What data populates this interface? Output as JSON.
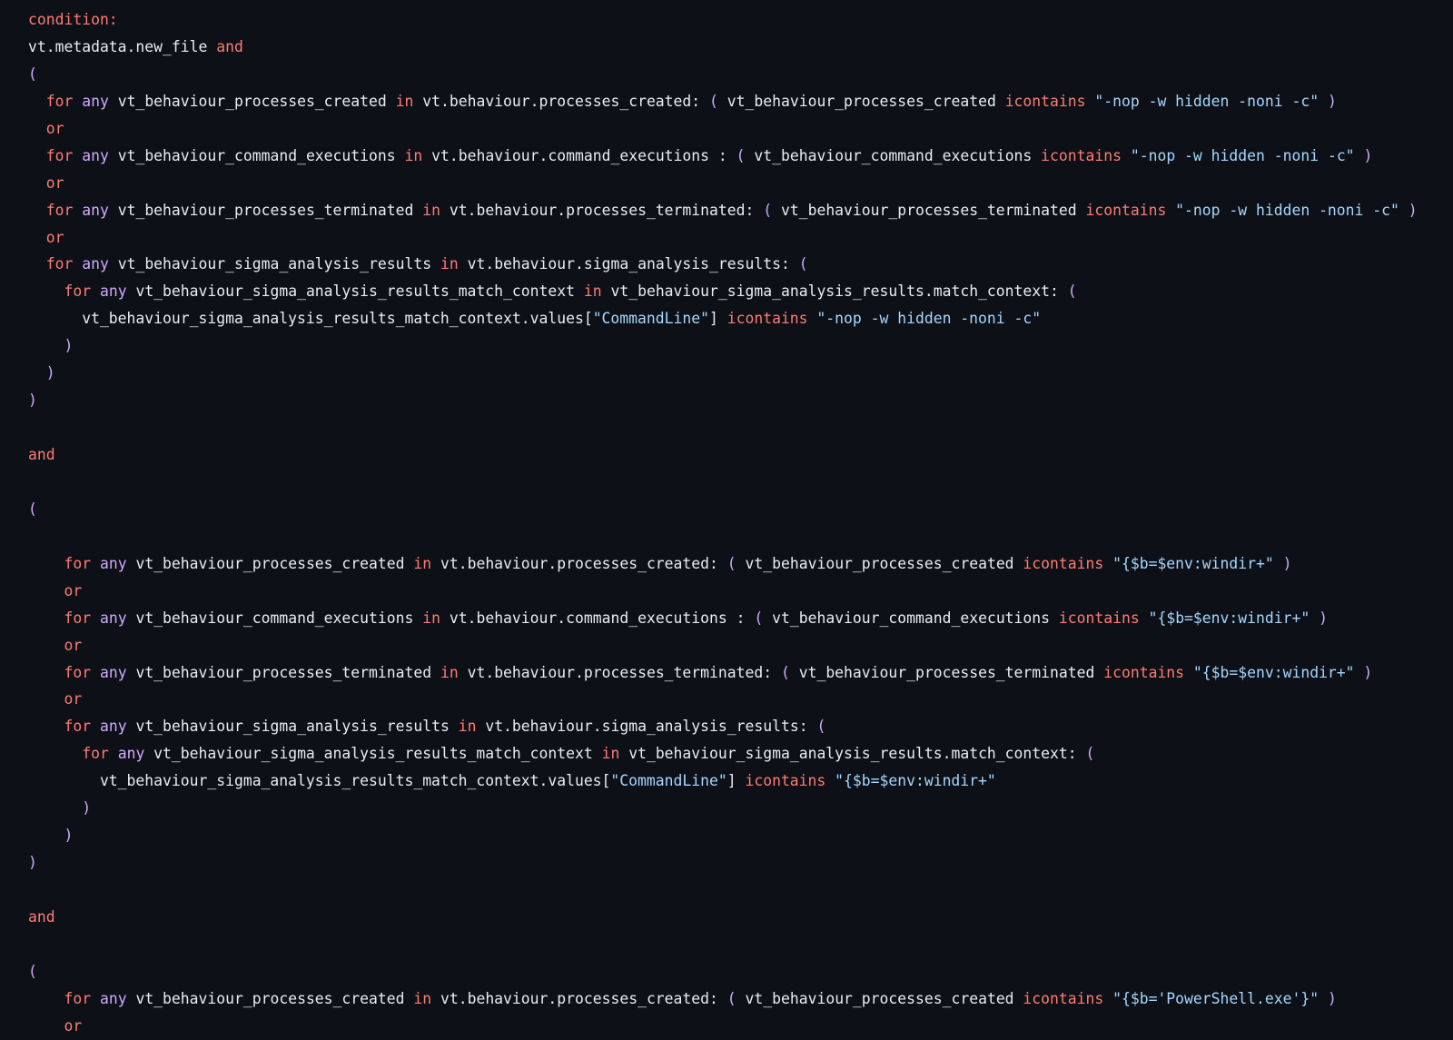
{
  "colors": {
    "background": "#0d1117",
    "plain": "#e6edf3",
    "keyword": "#ff7b72",
    "quantifier": "#d2a8ff",
    "string": "#a5d6ff",
    "paren": "#d2a8ff"
  },
  "lines": [
    [
      {
        "t": "condition:",
        "c": "kw"
      }
    ],
    [
      {
        "t": "vt.metadata.new_file ",
        "c": "plain"
      },
      {
        "t": "and",
        "c": "kw"
      }
    ],
    [
      {
        "t": "(",
        "c": "pl"
      }
    ],
    [
      {
        "t": "  ",
        "c": "plain"
      },
      {
        "t": "for",
        "c": "kw"
      },
      {
        "t": " ",
        "c": "plain"
      },
      {
        "t": "any",
        "c": "any"
      },
      {
        "t": " vt_behaviour_processes_created ",
        "c": "plain"
      },
      {
        "t": "in",
        "c": "kw"
      },
      {
        "t": " vt.behaviour.processes_created: ",
        "c": "plain"
      },
      {
        "t": "(",
        "c": "pl"
      },
      {
        "t": " vt_behaviour_processes_created ",
        "c": "plain"
      },
      {
        "t": "icontains",
        "c": "kw"
      },
      {
        "t": " \"-nop -w hidden -noni -c\"",
        "c": "str"
      },
      {
        "t": " ",
        "c": "plain"
      },
      {
        "t": ")",
        "c": "pl"
      }
    ],
    [
      {
        "t": "  ",
        "c": "plain"
      },
      {
        "t": "or",
        "c": "kw"
      }
    ],
    [
      {
        "t": "  ",
        "c": "plain"
      },
      {
        "t": "for",
        "c": "kw"
      },
      {
        "t": " ",
        "c": "plain"
      },
      {
        "t": "any",
        "c": "any"
      },
      {
        "t": " vt_behaviour_command_executions ",
        "c": "plain"
      },
      {
        "t": "in",
        "c": "kw"
      },
      {
        "t": " vt.behaviour.command_executions : ",
        "c": "plain"
      },
      {
        "t": "(",
        "c": "pl"
      },
      {
        "t": " vt_behaviour_command_executions ",
        "c": "plain"
      },
      {
        "t": "icontains",
        "c": "kw"
      },
      {
        "t": " \"-nop -w hidden -noni -c\"",
        "c": "str"
      },
      {
        "t": " ",
        "c": "plain"
      },
      {
        "t": ")",
        "c": "pl"
      }
    ],
    [
      {
        "t": "  ",
        "c": "plain"
      },
      {
        "t": "or",
        "c": "kw"
      }
    ],
    [
      {
        "t": "  ",
        "c": "plain"
      },
      {
        "t": "for",
        "c": "kw"
      },
      {
        "t": " ",
        "c": "plain"
      },
      {
        "t": "any",
        "c": "any"
      },
      {
        "t": " vt_behaviour_processes_terminated ",
        "c": "plain"
      },
      {
        "t": "in",
        "c": "kw"
      },
      {
        "t": " vt.behaviour.processes_terminated: ",
        "c": "plain"
      },
      {
        "t": "(",
        "c": "pl"
      },
      {
        "t": " vt_behaviour_processes_terminated ",
        "c": "plain"
      },
      {
        "t": "icontains",
        "c": "kw"
      },
      {
        "t": " \"-nop -w hidden -noni -c\"",
        "c": "str"
      },
      {
        "t": " ",
        "c": "plain"
      },
      {
        "t": ")",
        "c": "pl"
      }
    ],
    [
      {
        "t": "  ",
        "c": "plain"
      },
      {
        "t": "or",
        "c": "kw"
      }
    ],
    [
      {
        "t": "  ",
        "c": "plain"
      },
      {
        "t": "for",
        "c": "kw"
      },
      {
        "t": " ",
        "c": "plain"
      },
      {
        "t": "any",
        "c": "any"
      },
      {
        "t": " vt_behaviour_sigma_analysis_results ",
        "c": "plain"
      },
      {
        "t": "in",
        "c": "kw"
      },
      {
        "t": " vt.behaviour.sigma_analysis_results: ",
        "c": "plain"
      },
      {
        "t": "(",
        "c": "pl"
      }
    ],
    [
      {
        "t": "    ",
        "c": "plain"
      },
      {
        "t": "for",
        "c": "kw"
      },
      {
        "t": " ",
        "c": "plain"
      },
      {
        "t": "any",
        "c": "any"
      },
      {
        "t": " vt_behaviour_sigma_analysis_results_match_context ",
        "c": "plain"
      },
      {
        "t": "in",
        "c": "kw"
      },
      {
        "t": " vt_behaviour_sigma_analysis_results.match_context: ",
        "c": "plain"
      },
      {
        "t": "(",
        "c": "pl"
      }
    ],
    [
      {
        "t": "      vt_behaviour_sigma_analysis_results_match_context.values[",
        "c": "plain"
      },
      {
        "t": "\"CommandLine\"",
        "c": "str"
      },
      {
        "t": "] ",
        "c": "plain"
      },
      {
        "t": "icontains",
        "c": "kw"
      },
      {
        "t": " \"-nop -w hidden -noni -c\"",
        "c": "str"
      }
    ],
    [
      {
        "t": "    ",
        "c": "plain"
      },
      {
        "t": ")",
        "c": "pl"
      }
    ],
    [
      {
        "t": "  ",
        "c": "plain"
      },
      {
        "t": ")",
        "c": "pl"
      }
    ],
    [
      {
        "t": ")",
        "c": "pl"
      }
    ],
    [],
    [
      {
        "t": "and",
        "c": "kw"
      }
    ],
    [],
    [
      {
        "t": "(",
        "c": "pl"
      }
    ],
    [],
    [
      {
        "t": "    ",
        "c": "plain"
      },
      {
        "t": "for",
        "c": "kw"
      },
      {
        "t": " ",
        "c": "plain"
      },
      {
        "t": "any",
        "c": "any"
      },
      {
        "t": " vt_behaviour_processes_created ",
        "c": "plain"
      },
      {
        "t": "in",
        "c": "kw"
      },
      {
        "t": " vt.behaviour.processes_created: ",
        "c": "plain"
      },
      {
        "t": "(",
        "c": "pl"
      },
      {
        "t": " vt_behaviour_processes_created ",
        "c": "plain"
      },
      {
        "t": "icontains",
        "c": "kw"
      },
      {
        "t": " \"{$b=$env:windir+\"",
        "c": "str"
      },
      {
        "t": " ",
        "c": "plain"
      },
      {
        "t": ")",
        "c": "pl"
      }
    ],
    [
      {
        "t": "    ",
        "c": "plain"
      },
      {
        "t": "or",
        "c": "kw"
      }
    ],
    [
      {
        "t": "    ",
        "c": "plain"
      },
      {
        "t": "for",
        "c": "kw"
      },
      {
        "t": " ",
        "c": "plain"
      },
      {
        "t": "any",
        "c": "any"
      },
      {
        "t": " vt_behaviour_command_executions ",
        "c": "plain"
      },
      {
        "t": "in",
        "c": "kw"
      },
      {
        "t": " vt.behaviour.command_executions : ",
        "c": "plain"
      },
      {
        "t": "(",
        "c": "pl"
      },
      {
        "t": " vt_behaviour_command_executions ",
        "c": "plain"
      },
      {
        "t": "icontains",
        "c": "kw"
      },
      {
        "t": " \"{$b=$env:windir+\"",
        "c": "str"
      },
      {
        "t": " ",
        "c": "plain"
      },
      {
        "t": ")",
        "c": "pl"
      }
    ],
    [
      {
        "t": "    ",
        "c": "plain"
      },
      {
        "t": "or",
        "c": "kw"
      }
    ],
    [
      {
        "t": "    ",
        "c": "plain"
      },
      {
        "t": "for",
        "c": "kw"
      },
      {
        "t": " ",
        "c": "plain"
      },
      {
        "t": "any",
        "c": "any"
      },
      {
        "t": " vt_behaviour_processes_terminated ",
        "c": "plain"
      },
      {
        "t": "in",
        "c": "kw"
      },
      {
        "t": " vt.behaviour.processes_terminated: ",
        "c": "plain"
      },
      {
        "t": "(",
        "c": "pl"
      },
      {
        "t": " vt_behaviour_processes_terminated ",
        "c": "plain"
      },
      {
        "t": "icontains",
        "c": "kw"
      },
      {
        "t": " \"{$b=$env:windir+\"",
        "c": "str"
      },
      {
        "t": " ",
        "c": "plain"
      },
      {
        "t": ")",
        "c": "pl"
      }
    ],
    [
      {
        "t": "    ",
        "c": "plain"
      },
      {
        "t": "or",
        "c": "kw"
      }
    ],
    [
      {
        "t": "    ",
        "c": "plain"
      },
      {
        "t": "for",
        "c": "kw"
      },
      {
        "t": " ",
        "c": "plain"
      },
      {
        "t": "any",
        "c": "any"
      },
      {
        "t": " vt_behaviour_sigma_analysis_results ",
        "c": "plain"
      },
      {
        "t": "in",
        "c": "kw"
      },
      {
        "t": " vt.behaviour.sigma_analysis_results: ",
        "c": "plain"
      },
      {
        "t": "(",
        "c": "pl"
      }
    ],
    [
      {
        "t": "      ",
        "c": "plain"
      },
      {
        "t": "for",
        "c": "kw"
      },
      {
        "t": " ",
        "c": "plain"
      },
      {
        "t": "any",
        "c": "any"
      },
      {
        "t": " vt_behaviour_sigma_analysis_results_match_context ",
        "c": "plain"
      },
      {
        "t": "in",
        "c": "kw"
      },
      {
        "t": " vt_behaviour_sigma_analysis_results.match_context: ",
        "c": "plain"
      },
      {
        "t": "(",
        "c": "pl"
      }
    ],
    [
      {
        "t": "        vt_behaviour_sigma_analysis_results_match_context.values[",
        "c": "plain"
      },
      {
        "t": "\"CommandLine\"",
        "c": "str"
      },
      {
        "t": "] ",
        "c": "plain"
      },
      {
        "t": "icontains",
        "c": "kw"
      },
      {
        "t": " \"{$b=$env:windir+\"",
        "c": "str"
      }
    ],
    [
      {
        "t": "      ",
        "c": "plain"
      },
      {
        "t": ")",
        "c": "pl"
      }
    ],
    [
      {
        "t": "    ",
        "c": "plain"
      },
      {
        "t": ")",
        "c": "pl"
      }
    ],
    [
      {
        "t": ")",
        "c": "pl"
      }
    ],
    [],
    [
      {
        "t": "and",
        "c": "kw"
      }
    ],
    [],
    [
      {
        "t": "(",
        "c": "pl"
      }
    ],
    [
      {
        "t": "    ",
        "c": "plain"
      },
      {
        "t": "for",
        "c": "kw"
      },
      {
        "t": " ",
        "c": "plain"
      },
      {
        "t": "any",
        "c": "any"
      },
      {
        "t": " vt_behaviour_processes_created ",
        "c": "plain"
      },
      {
        "t": "in",
        "c": "kw"
      },
      {
        "t": " vt.behaviour.processes_created: ",
        "c": "plain"
      },
      {
        "t": "(",
        "c": "pl"
      },
      {
        "t": " vt_behaviour_processes_created ",
        "c": "plain"
      },
      {
        "t": "icontains",
        "c": "kw"
      },
      {
        "t": " \"{$b='PowerShell.exe'}\"",
        "c": "str"
      },
      {
        "t": " ",
        "c": "plain"
      },
      {
        "t": ")",
        "c": "pl"
      }
    ],
    [
      {
        "t": "    ",
        "c": "plain"
      },
      {
        "t": "or",
        "c": "kw"
      }
    ]
  ]
}
